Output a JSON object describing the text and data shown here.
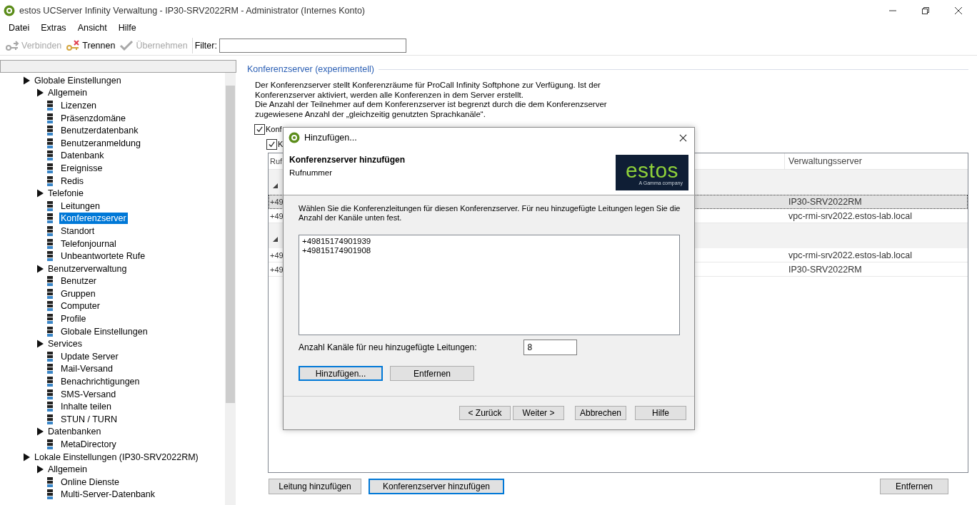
{
  "window": {
    "title": "estos UCServer Infinity Verwaltung - IP30-SRV2022RM - Administrator (Internes Konto)"
  },
  "menu": [
    "Datei",
    "Extras",
    "Ansicht",
    "Hilfe"
  ],
  "toolbar": {
    "buttons": [
      {
        "kind": "connect",
        "label": "Verbinden",
        "disabled": true
      },
      {
        "kind": "disconnect",
        "label": "Trennen",
        "disabled": false
      },
      {
        "kind": "apply",
        "label": "Übernehmen",
        "disabled": true
      }
    ],
    "filter_label": "Filter:"
  },
  "tree": [
    {
      "label": "Globale Einstellungen",
      "selected": false,
      "children": [
        {
          "label": "Allgemein",
          "selected": false,
          "children": [
            {
              "label": "Lizenzen",
              "selected": false
            },
            {
              "label": "Präsenzdomäne",
              "selected": false
            },
            {
              "label": "Benutzerdatenbank",
              "selected": false
            },
            {
              "label": "Benutzeranmeldung",
              "selected": false
            },
            {
              "label": "Datenbank",
              "selected": false
            },
            {
              "label": "Ereignisse",
              "selected": false
            },
            {
              "label": "Redis",
              "selected": false
            }
          ]
        },
        {
          "label": "Telefonie",
          "selected": false,
          "children": [
            {
              "label": "Leitungen",
              "selected": false
            },
            {
              "label": "Konferenzserver",
              "selected": true
            },
            {
              "label": "Standort",
              "selected": false
            },
            {
              "label": "Telefonjournal",
              "selected": false
            },
            {
              "label": "Unbeantwortete Rufe",
              "selected": false
            }
          ]
        },
        {
          "label": "Benutzerverwaltung",
          "selected": false,
          "children": [
            {
              "label": "Benutzer",
              "selected": false
            },
            {
              "label": "Gruppen",
              "selected": false
            },
            {
              "label": "Computer",
              "selected": false
            },
            {
              "label": "Profile",
              "selected": false
            },
            {
              "label": "Globale Einstellungen",
              "selected": false
            }
          ]
        },
        {
          "label": "Services",
          "selected": false,
          "children": [
            {
              "label": "Update Server",
              "selected": false
            },
            {
              "label": "Mail-Versand",
              "selected": false
            },
            {
              "label": "Benachrichtigungen",
              "selected": false
            },
            {
              "label": "SMS-Versand",
              "selected": false
            },
            {
              "label": "Inhalte teilen",
              "selected": false
            },
            {
              "label": "STUN / TURN",
              "selected": false
            }
          ]
        },
        {
          "label": "Datenbanken",
          "selected": false,
          "children": [
            {
              "label": "MetaDirectory",
              "selected": false
            }
          ]
        }
      ]
    },
    {
      "label": "Lokale Einstellungen (IP30-SRV2022RM)",
      "selected": false,
      "children": [
        {
          "label": "Allgemein",
          "selected": false,
          "children": [
            {
              "label": "Online Dienste",
              "selected": false
            },
            {
              "label": "Multi-Server-Datenbank",
              "selected": false
            }
          ]
        }
      ]
    }
  ],
  "section_title": "Konferenzserver (experimentell)",
  "description": [
    "Der Konferenzserver stellt Konferenzräume für ProCall Infinity Softphone zur Verfügung. Ist der Konferenzserver aktiviert, werden alle Konferenzen in dem Server erstellt.",
    "Die Anzahl der Teilnehmer auf dem Konferenzserver ist begrenzt durch die dem Konferenzserver zugewiesene Anzahl der „gleichzeitig genutzten Sprachkanäle“."
  ],
  "checkboxes": [
    {
      "label": "Konf",
      "checked": true
    },
    {
      "label": "K",
      "checked": true
    }
  ],
  "table": {
    "columns": [
      "Ruf",
      "Verwaltungsserver"
    ],
    "rows": [
      {
        "kind": "group"
      },
      {
        "kind": "row",
        "number": "+49",
        "server": "IP30-SRV2022RM",
        "selected": true
      },
      {
        "kind": "row",
        "number": "+49",
        "server": "vpc-rmi-srv2022.estos-lab.local",
        "selected": false
      },
      {
        "kind": "group"
      },
      {
        "kind": "row",
        "number": "+49",
        "server": "vpc-rmi-srv2022.estos-lab.local",
        "selected": false
      },
      {
        "kind": "row",
        "number": "+49",
        "server": "IP30-SRV2022RM",
        "selected": false
      }
    ]
  },
  "buttons": [
    {
      "label": "Leitung hinzufügen",
      "focused": false
    },
    {
      "label": "Konferenzserver hinzufügen",
      "focused": true
    },
    {
      "label": "Entfernen",
      "focused": false
    }
  ],
  "dialog": {
    "title": "Hinzufügen...",
    "heading": "Konferenzserver hinzufügen",
    "subheading": "Rufnummer",
    "logo": {
      "text": "estos",
      "tagline": "A Gamma company"
    },
    "instruction": "Wählen Sie die Konferenzleitungen für diesen Konferenzserver. Für neu hinzugefügte Leitungen legen Sie die Anzahl der Kanäle unten fest.",
    "lines": [
      "+49815174901939",
      "+49815174901908"
    ],
    "channels_label": "Anzahl Kanäle für neu hinzugefügte Leitungen:",
    "channels_value": "8",
    "list_buttons": [
      {
        "label": "Hinzufügen...",
        "focused": true
      },
      {
        "label": "Entfernen",
        "focused": false
      }
    ],
    "footer_buttons": [
      "< Zurück",
      "Weiter >",
      "Abbrechen",
      "Hilfe"
    ]
  }
}
